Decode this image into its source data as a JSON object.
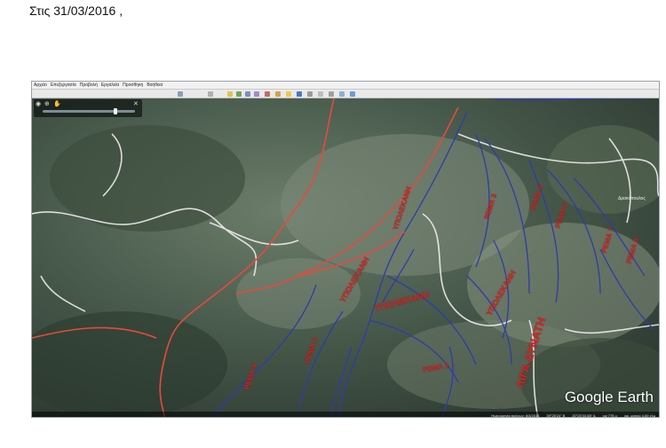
{
  "header": {
    "date_text": "Στις 31/03/2016 ,"
  },
  "menu": {
    "items": [
      "Αρχείο",
      "Επεξεργασία",
      "Προβολή",
      "Εργαλεία",
      "Προσθήκη",
      "Βοήθεια"
    ]
  },
  "map": {
    "labels": {
      "rema_1": "ΡΕΜΑ 1",
      "rema_2": "ΡΕΜΑ 2",
      "rema_3": "ΡΕΜΑ 3",
      "rema_4": "ΡΕΜΑ 4",
      "rema_5": "ΡΕΜΑ 5",
      "rema_6": "ΡΕΜΑ 6",
      "rema_7": "ΡΕΜΑ 7",
      "rema_8": "ΡΕΜΑ 8",
      "ypoleka_1": "ΥΠΟΛΕΚΑΝΗ",
      "ypoleka_2": "ΥΠΟΛΕΚΑΝΗ",
      "ypoleka_3": "ΥΠΟΛΕΚΑΝΗ",
      "ypoleka_4": "ΥΠΟΛΕΚΑΝΗ",
      "dynati": "ΛΙΓΑ ΔΥΝΑΤΗ",
      "village": "Δρακόπουλος"
    },
    "logo": "Google Earth",
    "status": [
      "Ημερομηνία εικόνων: 6/3/2015",
      "39°25'24\" Β",
      "20°20'33.58\" Α",
      "υψ 775 μ",
      "υψ. ματιού 4.60 χλμ"
    ]
  },
  "colors": {
    "road": "#e64a3c",
    "stream": "#2f3ca8",
    "track": "#f0f0f0",
    "label": "#e02020"
  }
}
